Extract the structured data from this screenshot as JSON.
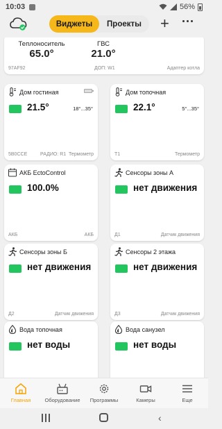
{
  "status_bar": {
    "time": "10:03",
    "battery_percent": "56%"
  },
  "header": {
    "tabs": [
      {
        "label": "Виджеты",
        "active": true
      },
      {
        "label": "Проекты",
        "active": false
      }
    ],
    "add_icon": "plus-icon",
    "more_icon": "more-dots-icon"
  },
  "cards": {
    "boiler": {
      "left_label": "Теплоноситель",
      "left_value": "65.0°",
      "right_label": "ГВС",
      "right_value": "21.0°",
      "footer_left": "97AF92",
      "footer_mid": "ДОП: W1",
      "footer_right": "Адаптер котла"
    },
    "living_room": {
      "title": "Дом гостиная",
      "value": "21.5°",
      "range": "18°...35°",
      "footer_left": "5B0CCE",
      "footer_mid": "РАДИО: R1",
      "footer_right": "Термометр"
    },
    "furnace_room": {
      "title": "Дом топочная",
      "value": "22.1°",
      "range": "5°...35°",
      "footer_left": "T1",
      "footer_right": "Термометр"
    },
    "akb": {
      "title": "АКБ EctoControl",
      "value": "100.0%",
      "footer_left": "АКБ",
      "footer_right": "АКБ"
    },
    "zone_a": {
      "title": "Сенсоры зоны А",
      "value": "нет движения",
      "footer_left": "Д1",
      "footer_right": "Датчик движения"
    },
    "zone_b": {
      "title": "Сенсоры зоны Б",
      "value": "нет движения",
      "footer_left": "Д2",
      "footer_right": "Датчик движения"
    },
    "floor2": {
      "title": "Сенсоры 2 этажа",
      "value": "нет движения",
      "footer_left": "Д3",
      "footer_right": "Датчик движения"
    },
    "water_furnace": {
      "title": "Вода топочная",
      "value": "нет воды"
    },
    "water_bath": {
      "title": "Вода санузел",
      "value": "нет воды"
    }
  },
  "bottom_nav": [
    {
      "label": "Главная",
      "icon": "home-icon",
      "active": true
    },
    {
      "label": "Оборудование",
      "icon": "router-icon",
      "active": false
    },
    {
      "label": "Программы",
      "icon": "gear-icon",
      "active": false
    },
    {
      "label": "Камеры",
      "icon": "camera-icon",
      "active": false
    },
    {
      "label": "Еще",
      "icon": "menu-icon",
      "active": false
    }
  ],
  "colors": {
    "accent": "#f5b719",
    "active_nav": "#f5a300",
    "toggle_on": "#22c55e"
  }
}
